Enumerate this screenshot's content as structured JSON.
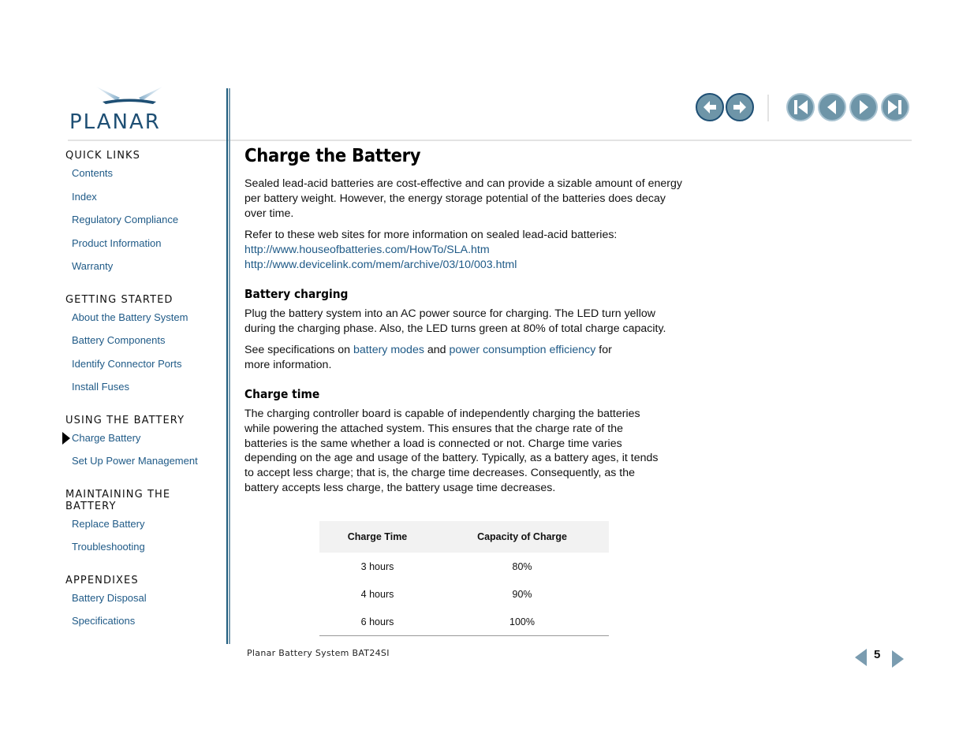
{
  "brand": {
    "logo_text": "PLANAR",
    "color": "#1e4f74"
  },
  "sidebar": {
    "sections": [
      {
        "heading": "QUICK LINKS",
        "items": [
          "Contents",
          "Index",
          "Regulatory Compliance",
          "Product Information",
          "Warranty"
        ]
      },
      {
        "heading": "GETTING STARTED",
        "items": [
          "About the Battery System",
          "Battery Components",
          "Identify Connector Ports",
          "Install Fuses"
        ]
      },
      {
        "heading": "USING THE BATTERY",
        "items": [
          "Charge Battery",
          "Set Up Power Management"
        ],
        "active_item": "Charge Battery"
      },
      {
        "heading": "MAINTAINING THE BATTERY",
        "items": [
          "Replace Battery",
          "Troubleshooting"
        ]
      },
      {
        "heading": "APPENDIXES",
        "items": [
          "Battery Disposal",
          "Specifications"
        ]
      }
    ]
  },
  "topnav": {
    "buttons": [
      "back-icon",
      "forward-icon",
      "first-page-icon",
      "previous-page-icon",
      "next-page-icon",
      "last-page-icon"
    ]
  },
  "main": {
    "title": "Charge the Battery",
    "intro": "Sealed lead-acid batteries are cost-effective and can provide a sizable amount of energy per battery weight. However, the energy storage potential of the batteries does decay over time.",
    "refer": "Refer to these web sites for more information on sealed lead-acid batteries:",
    "links": [
      "http://www.houseofbatteries.com/HowTo/SLA.htm",
      "http://www.devicelink.com/mem/archive/03/10/003.html"
    ],
    "charging_heading": "Battery charging",
    "charging_text": "Plug the battery system into an AC power source for charging. The LED turn yellow during the charging phase. Also, the LED turns green at 80% of total charge capacity.",
    "see_prefix": "See specifications on ",
    "see_link1": "battery modes",
    "see_and": " and ",
    "see_link2": "power consumption efficiency",
    "see_suffix": " for more information.",
    "time_heading": "Charge time",
    "time_text": "The charging controller board is capable of independently charging the batteries while powering the attached system. This ensures that the charge rate of the batteries is the same whether a load is connected or not. Charge time varies depending on the age and usage of the battery. Typically, as a battery ages, it tends to accept less charge; that is, the charge time decreases. Consequently, as the battery accepts less charge, the battery usage time decreases."
  },
  "table": {
    "headers": [
      "Charge Time",
      "Capacity of Charge"
    ],
    "rows": [
      [
        "3 hours",
        "80%"
      ],
      [
        "4 hours",
        "90%"
      ],
      [
        "6 hours",
        "100%"
      ]
    ]
  },
  "footer": {
    "doc_title": "Planar Battery System BAT24SI",
    "page": "5"
  }
}
